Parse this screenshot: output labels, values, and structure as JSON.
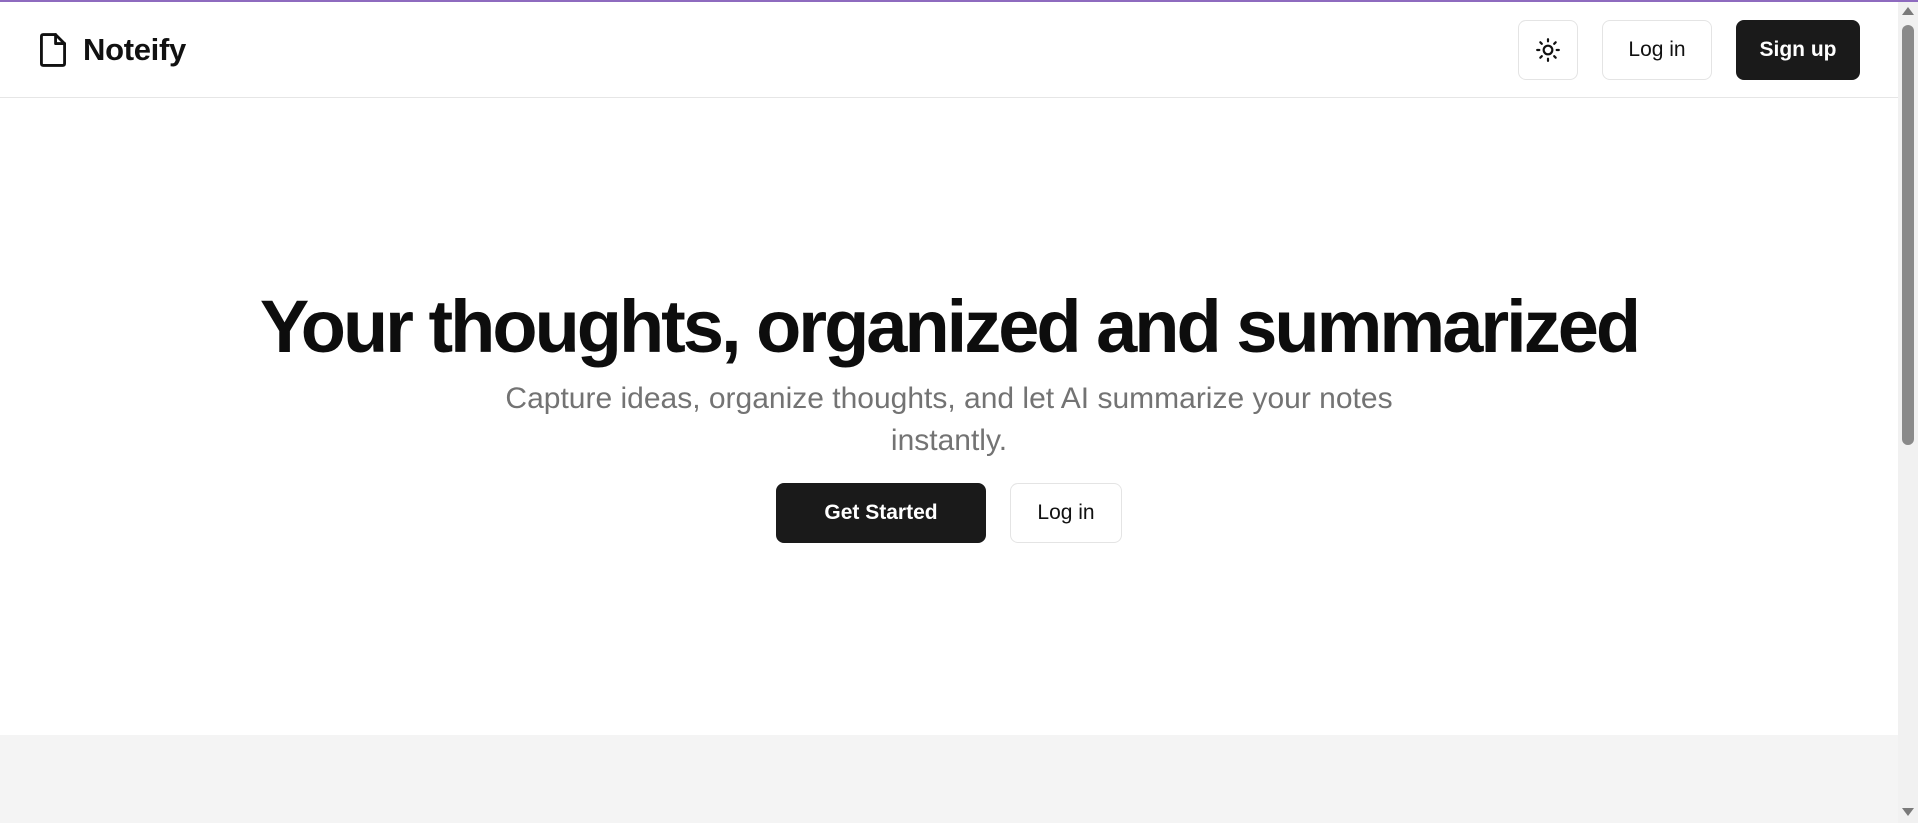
{
  "header": {
    "brand_name": "Noteify",
    "brand_icon": "file-icon",
    "theme_toggle_icon": "sun-icon",
    "login_label": "Log in",
    "signup_label": "Sign up"
  },
  "hero": {
    "title": "Your thoughts, organized and summarized",
    "subtitle": "Capture ideas, organize thoughts, and let AI summarize your notes instantly.",
    "primary_button_label": "Get Started",
    "secondary_button_label": "Log in"
  },
  "colors": {
    "accent_top_border": "#8e6bbf",
    "primary_button_bg": "#1a1a1a",
    "subtitle_text": "#737373",
    "lower_band_bg": "#f4f4f4"
  }
}
